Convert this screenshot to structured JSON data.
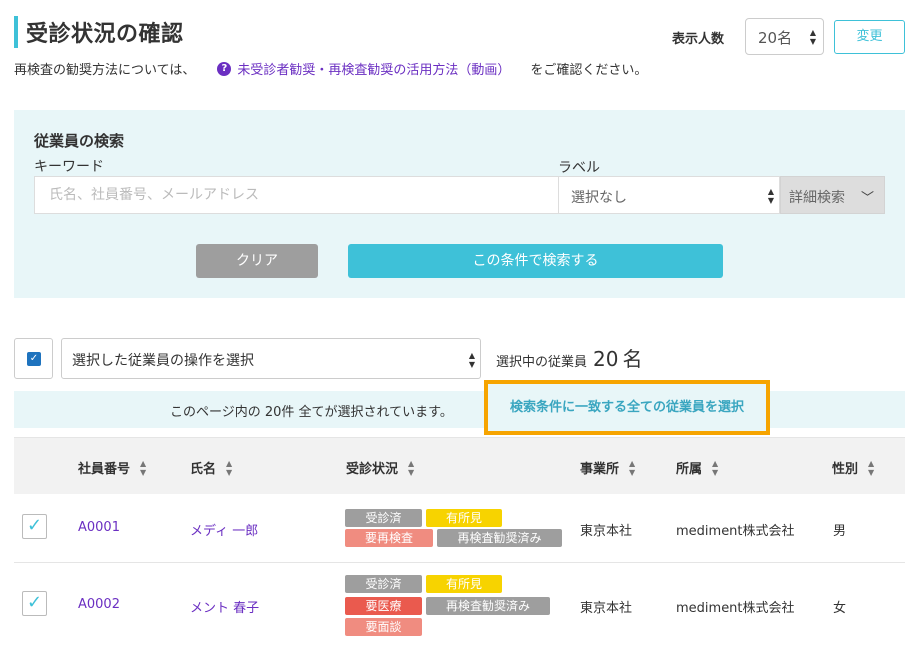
{
  "header": {
    "title": "受診状況の確認",
    "info_prefix": "再検査の勧奨方法については、",
    "help_icon": "?",
    "info_link": "未受診者勧奨・再検査勧奨の活用方法（動画）",
    "info_suffix": "をご確認ください。",
    "per_page_label": "表示人数",
    "per_page_value": "20名",
    "change_button": "変更"
  },
  "search": {
    "heading": "従業員の検索",
    "keyword_label": "キーワード",
    "keyword_placeholder": "氏名、社員番号、メールアドレス",
    "keyword_value": "",
    "label_label": "ラベル",
    "label_value": "選択なし",
    "detail_button": "詳細検索",
    "clear_button": "クリア",
    "submit_button": "この条件で検索する"
  },
  "bulk": {
    "operation_placeholder": "選択した従業員の操作を選択",
    "selected_label": "選択中の従業員",
    "selected_count": "20",
    "selected_unit": "名",
    "banner_message": "このページ内の 20件 全てが選択されています。",
    "select_all_link": "検索条件に一致する全ての従業員を選択"
  },
  "table": {
    "columns": [
      "社員番号",
      "氏名",
      "受診状況",
      "事業所",
      "所属",
      "性別"
    ],
    "rows": [
      {
        "id": "A0001",
        "name": "メディ 一郎",
        "badges": [
          "受診済",
          "有所見",
          "要再検査",
          "再検査勧奨済み"
        ],
        "office": "東京本社",
        "dept": "mediment株式会社",
        "gender": "男"
      },
      {
        "id": "A0002",
        "name": "メント 春子",
        "badges": [
          "受診済",
          "有所見",
          "要医療",
          "再検査勧奨済み",
          "要面談"
        ],
        "office": "東京本社",
        "dept": "mediment株式会社",
        "gender": "女"
      }
    ]
  },
  "colors": {
    "accent": "#3ec1d8",
    "link": "#6b2fc2",
    "highlight": "#f6a400",
    "badge_gray": "#9e9e9e",
    "badge_yellow": "#f7d300",
    "badge_pink": "#f08c80",
    "badge_red": "#ea5a4e"
  }
}
